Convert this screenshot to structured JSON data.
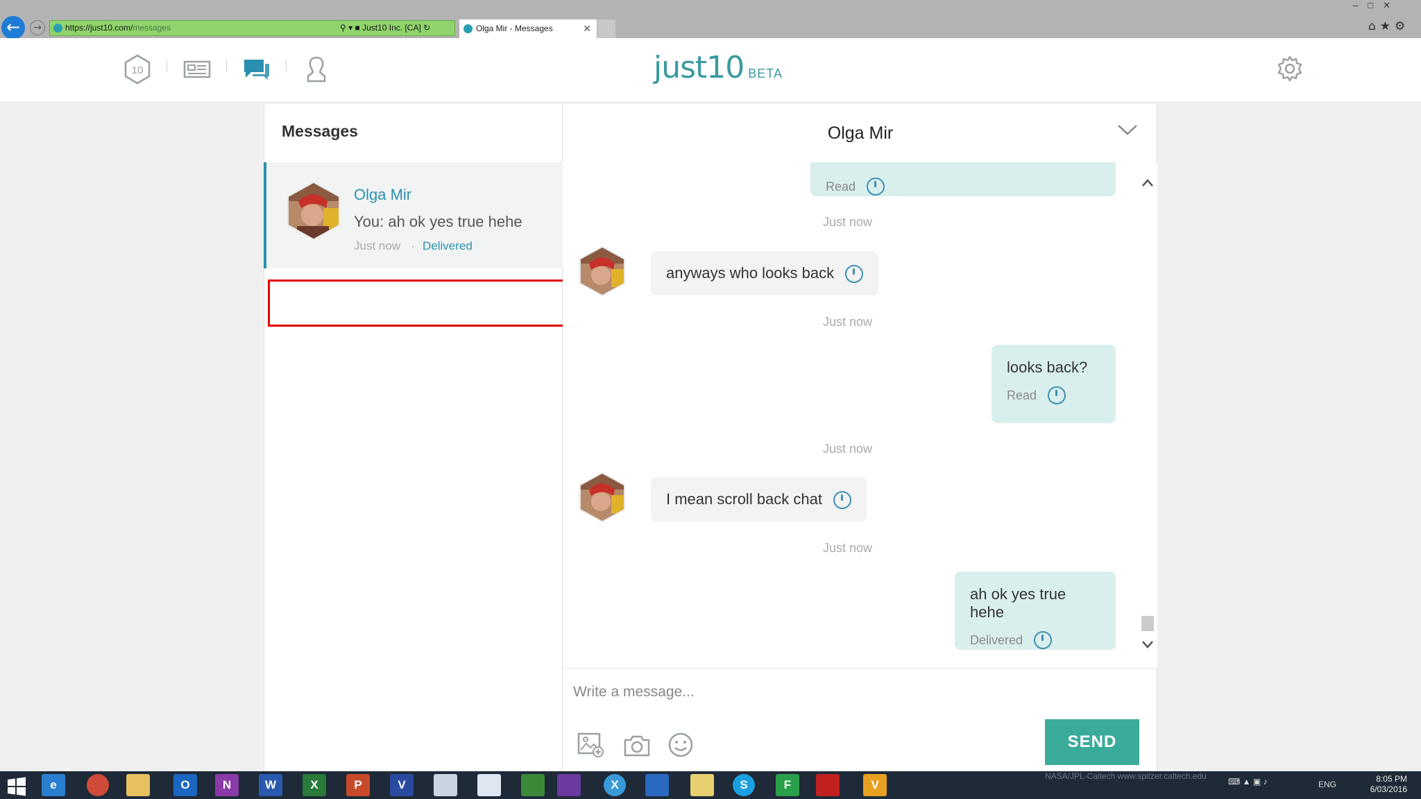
{
  "browser": {
    "url_host": "https://just10.com/",
    "url_path": "messages",
    "site_identity": "Just10 Inc. [CA]",
    "tab_title": "Olga Mir - Messages"
  },
  "header": {
    "logo_word": "just10",
    "logo_badge": "BETA",
    "nav_just10_label": "10"
  },
  "sidebar": {
    "title": "Messages",
    "conversation": {
      "name": "Olga Mir",
      "last_message": "You: ah ok yes true hehe",
      "time": "Just now",
      "separator": "·",
      "status": "Delivered"
    }
  },
  "chat": {
    "title": "Olga Mir",
    "messages": [
      {
        "direction": "out",
        "text": "",
        "status": "Read"
      },
      {
        "timestamp": "Just now"
      },
      {
        "direction": "in",
        "text": "anyways who looks back"
      },
      {
        "timestamp": "Just now"
      },
      {
        "direction": "out",
        "text": "looks back?",
        "status": "Read"
      },
      {
        "timestamp": "Just now"
      },
      {
        "direction": "in",
        "text": "I mean scroll back chat"
      },
      {
        "timestamp": "Just now"
      },
      {
        "direction": "out",
        "text": "ah ok yes true hehe",
        "status": "Delivered"
      }
    ],
    "compose_placeholder": "Write a message...",
    "send_label": "SEND"
  },
  "taskbar": {
    "apps": [
      "windows-start",
      "internet-explorer",
      "chrome",
      "file-explorer",
      "outlook",
      "onenote",
      "word",
      "excel",
      "powerpoint",
      "visio",
      "calculator",
      "snipping-tool",
      "project",
      "visual-studio",
      "xamarin",
      "dev-tools",
      "folder",
      "skype",
      "frame-app",
      "acrobat",
      "vectorworks"
    ],
    "lang": "ENG",
    "time": "8:05 PM",
    "date": "6/03/2016",
    "watermark": "NASA/JPL-Caltech   www.spitzer.caltech.edu"
  }
}
